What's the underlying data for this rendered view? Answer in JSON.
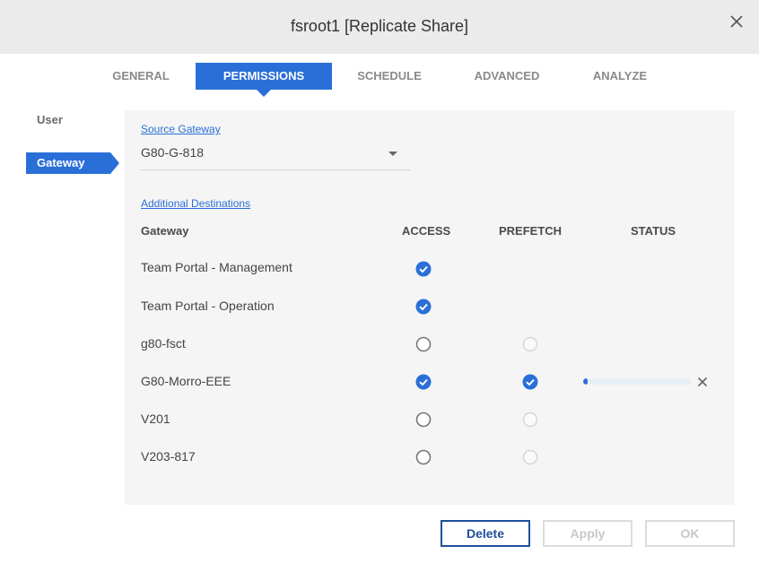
{
  "window": {
    "title": "fsroot1 [Replicate Share]"
  },
  "tabs": [
    {
      "label": "GENERAL",
      "active": false
    },
    {
      "label": "PERMISSIONS",
      "active": true
    },
    {
      "label": "SCHEDULE",
      "active": false
    },
    {
      "label": "ADVANCED",
      "active": false
    },
    {
      "label": "ANALYZE",
      "active": false
    }
  ],
  "sidebar": {
    "items": [
      {
        "label": "User",
        "active": false
      },
      {
        "label": "Gateway",
        "active": true
      }
    ]
  },
  "source": {
    "label": "Source Gateway",
    "value": "G80-G-818"
  },
  "destinations": {
    "label": "Additional Destinations",
    "columns": [
      "Gateway",
      "ACCESS",
      "PREFETCH",
      "STATUS"
    ],
    "rows": [
      {
        "name": "Team Portal - Management",
        "access": "checked",
        "prefetch": "none",
        "status": ""
      },
      {
        "name": "Team Portal - Operation",
        "access": "checked",
        "prefetch": "none",
        "status": ""
      },
      {
        "name": "g80-fsct",
        "access": "unchecked",
        "prefetch": "disabled",
        "status": ""
      },
      {
        "name": "G80-Morro-EEE",
        "access": "checked",
        "prefetch": "checked",
        "status": "progress",
        "progress": 0.03
      },
      {
        "name": "V201",
        "access": "unchecked",
        "prefetch": "disabled",
        "status": ""
      },
      {
        "name": "V203-817",
        "access": "unchecked",
        "prefetch": "disabled",
        "status": ""
      }
    ]
  },
  "buttons": {
    "delete": "Delete",
    "apply": "Apply",
    "ok": "OK"
  },
  "colors": {
    "accent": "#2a6fd8",
    "title_bar": "#ebebeb",
    "panel": "#f5f5f5"
  }
}
